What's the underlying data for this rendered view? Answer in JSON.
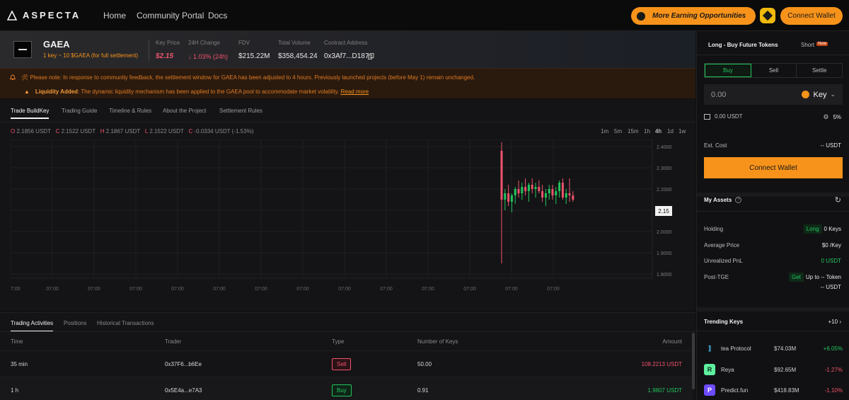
{
  "nav": {
    "brand": "ASPECTA",
    "links": [
      "Home",
      "Community Portal",
      "Docs"
    ],
    "earn_button": "More Earning Opportunities",
    "connect_wallet": "Connect Wallet"
  },
  "token": {
    "name": "GAEA",
    "subtitle": "1 key ~ 10 $GAEA (for full settlement)",
    "stats": {
      "key_price_label": "Key Price",
      "key_price": "$2.15",
      "change_label": "24H Change",
      "change": "↓ 1.03% (24h)",
      "fdv_label": "FDV",
      "fdv": "$215.22M",
      "volume_label": "Total Volume",
      "volume": "$358,454.24",
      "contract_label": "Contract Address",
      "contract": "0x3Af7...D187"
    }
  },
  "notice": {
    "line1": "🛠 Please note: In response to community feedback, the settlement window for GAEA has been adjusted to 4 hours. Previously launched projects (before May 1) remain unchanged.",
    "line2_title": "Liquidity Added",
    "line2_text": ": The dynamic liquidity mechanism has been applied to the GAEA pool to accommodate market volatility.",
    "read_more": "Read more"
  },
  "chart_tabs": [
    "Trade BuildKey",
    "Trading Guide",
    "Timeline & Rules",
    "About the Project",
    "Settlement Rules"
  ],
  "ohlc": {
    "o": "2.1856 USDT",
    "c": "2.1522 USDT",
    "h": "2.1867 USDT",
    "l": "2.1522 USDT",
    "chg": "-0.0334 USDT (-1.53%)"
  },
  "timeframes": [
    "1m",
    "5m",
    "15m",
    "1h",
    "4h",
    "1d",
    "1w"
  ],
  "timeframe_active": "4h",
  "chart_data": {
    "type": "candlestick",
    "ylim": [
      1.8,
      2.4
    ],
    "y_ticks": [
      "2.4000",
      "2.3000",
      "2.2000",
      "2.1000",
      "2.0000",
      "1.9000",
      "1.8000"
    ],
    "x_ticks": [
      "7:00",
      "07:00",
      "07:00",
      "07:00",
      "07:00",
      "07:00",
      "07:00",
      "07:00",
      "07:00",
      "07:00",
      "07:00",
      "07:00",
      "07:00",
      "07:00"
    ],
    "last_price": "2.15",
    "candles": [
      {
        "o": 2.38,
        "h": 2.42,
        "l": 1.85,
        "c": 2.15
      },
      {
        "o": 2.15,
        "h": 2.2,
        "l": 2.1,
        "c": 2.18
      },
      {
        "o": 2.18,
        "h": 2.22,
        "l": 2.12,
        "c": 2.14
      },
      {
        "o": 2.14,
        "h": 2.18,
        "l": 2.09,
        "c": 2.17
      },
      {
        "o": 2.17,
        "h": 2.21,
        "l": 2.13,
        "c": 2.2
      },
      {
        "o": 2.2,
        "h": 2.24,
        "l": 2.16,
        "c": 2.18
      },
      {
        "o": 2.18,
        "h": 2.23,
        "l": 2.15,
        "c": 2.21
      },
      {
        "o": 2.21,
        "h": 2.25,
        "l": 2.17,
        "c": 2.19
      },
      {
        "o": 2.19,
        "h": 2.23,
        "l": 2.14,
        "c": 2.22
      },
      {
        "o": 2.22,
        "h": 2.25,
        "l": 2.18,
        "c": 2.2
      },
      {
        "o": 2.2,
        "h": 2.23,
        "l": 2.16,
        "c": 2.21
      },
      {
        "o": 2.21,
        "h": 2.24,
        "l": 2.18,
        "c": 2.19
      },
      {
        "o": 2.19,
        "h": 2.22,
        "l": 2.14,
        "c": 2.16
      },
      {
        "o": 2.16,
        "h": 2.2,
        "l": 2.12,
        "c": 2.18
      },
      {
        "o": 2.18,
        "h": 2.22,
        "l": 2.15,
        "c": 2.2
      },
      {
        "o": 2.2,
        "h": 2.22,
        "l": 2.15,
        "c": 2.17
      },
      {
        "o": 2.17,
        "h": 2.21,
        "l": 2.13,
        "c": 2.19
      },
      {
        "o": 2.19,
        "h": 2.24,
        "l": 2.16,
        "c": 2.23
      },
      {
        "o": 2.23,
        "h": 2.25,
        "l": 2.15,
        "c": 2.16
      },
      {
        "o": 2.16,
        "h": 2.2,
        "l": 2.13,
        "c": 2.18
      },
      {
        "o": 2.18,
        "h": 2.25,
        "l": 2.14,
        "c": 2.17
      },
      {
        "o": 2.17,
        "h": 2.19,
        "l": 2.14,
        "c": 2.15
      }
    ]
  },
  "trades": {
    "tabs": [
      "Trading Activities",
      "Positions",
      "Historical Transactions"
    ],
    "headers": [
      "Time",
      "Trader",
      "Type",
      "Number of Keys",
      "Amount"
    ],
    "rows": [
      {
        "time": "35 min",
        "trader": "0x37F6...b6Ee",
        "type": "Sell",
        "keys": "50.00",
        "amount": "108.2213 USDT"
      },
      {
        "time": "1 h",
        "trader": "0x5E4a...e7A3",
        "type": "Buy",
        "keys": "0.91",
        "amount": "1.9807 USDT"
      }
    ]
  },
  "trade_panel": {
    "tab_long": "Long - Buy Future Tokens",
    "tab_short": "Short",
    "new_badge": "New",
    "segments": [
      "Buy",
      "Sell",
      "Settle"
    ],
    "amount_value": "0.00",
    "amount_token": "Key",
    "balance": "0.00 USDT",
    "slippage": "5%",
    "est_cost_label": "Est. Cost",
    "est_cost_value": "-- USDT",
    "connect_wallet": "Connect Wallet"
  },
  "assets": {
    "title": "My Assets",
    "holding_label": "Holding",
    "holding_tag": "Long",
    "holding_value": "0 Keys",
    "avg_label": "Average Price",
    "avg_value": "$0 /Key",
    "pnl_label": "Unrealized PnL",
    "pnl_value": "0 USDT",
    "post_label": "Post-TGE",
    "post_tag": "Get",
    "post_value1": "Up to -- Token",
    "post_value2": "-- USDT"
  },
  "trending": {
    "title": "Trending Keys",
    "more": "+10",
    "items": [
      {
        "name": "tea Protocol",
        "value": "$74.03M",
        "change": "+6.05%",
        "positive": true
      },
      {
        "name": "Reya",
        "value": "$92.65M",
        "change": "-1.27%",
        "positive": false
      },
      {
        "name": "Predict.fun",
        "value": "$418.83M",
        "change": "-1.10%",
        "positive": false
      }
    ]
  }
}
